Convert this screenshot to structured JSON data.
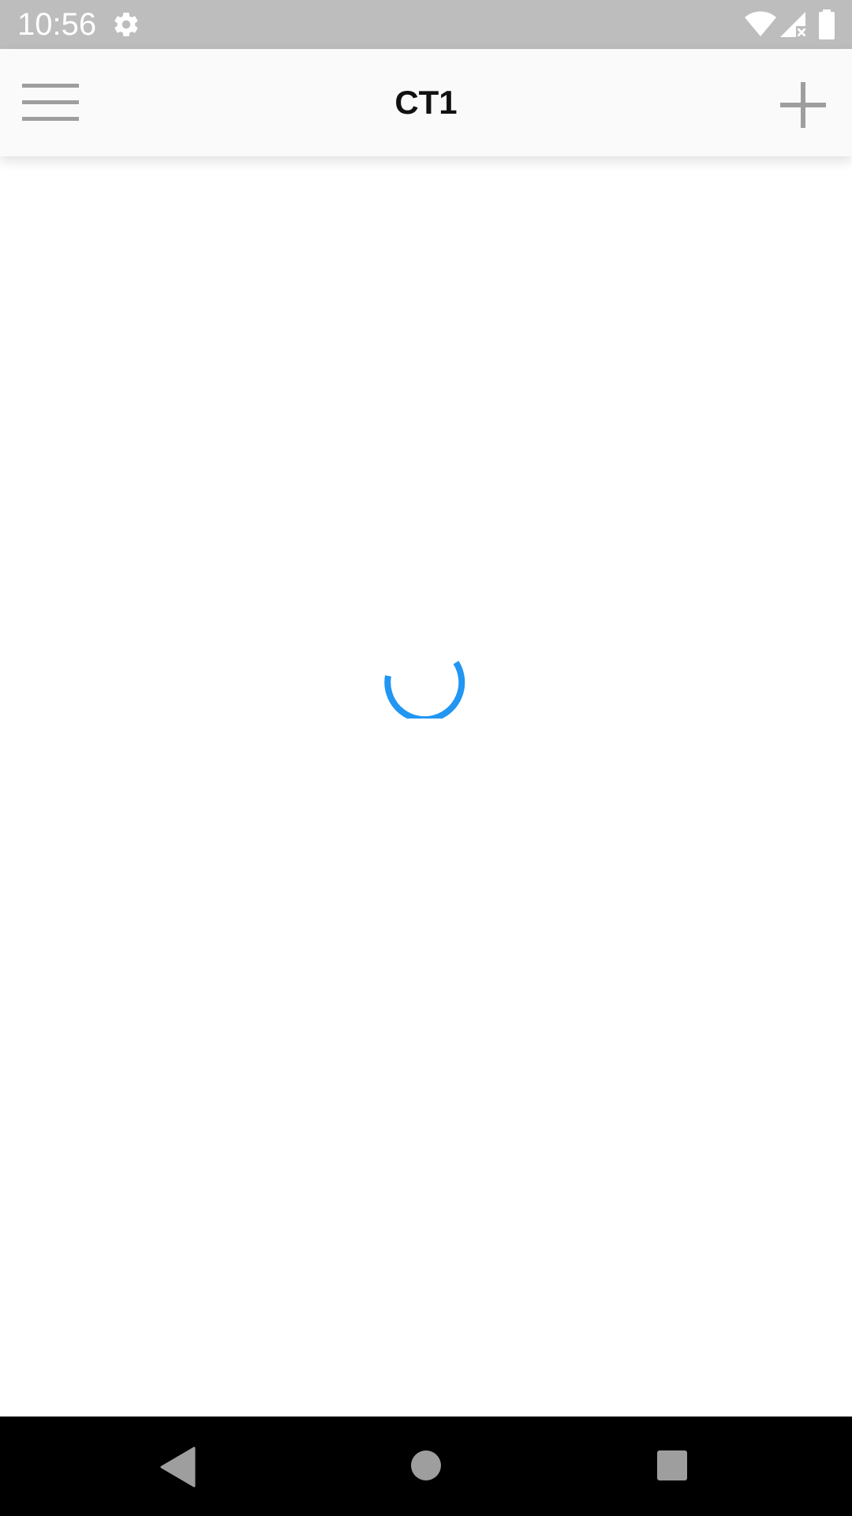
{
  "status_bar": {
    "time": "10:56",
    "icons": [
      "gear-icon",
      "wifi-icon",
      "signal-no-service-icon",
      "battery-icon"
    ]
  },
  "app_bar": {
    "title": "CT1",
    "menu_icon": "hamburger-menu-icon",
    "add_icon": "plus-icon"
  },
  "content": {
    "state": "loading",
    "spinner_color": "#2196f3"
  },
  "nav_bar": {
    "icons": [
      "back-icon",
      "home-icon",
      "recents-icon"
    ]
  },
  "colors": {
    "status_bar_bg": "#bdbdbd",
    "app_bar_bg": "#fafafa",
    "icon_gray": "#9e9e9e",
    "accent": "#2196f3",
    "nav_bar_bg": "#000000"
  }
}
